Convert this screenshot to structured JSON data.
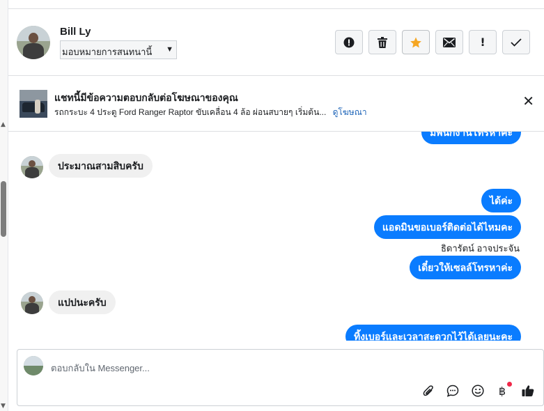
{
  "header": {
    "contact_name": "Bill Ly",
    "assign_label": "มอบหมายการสนทนานี้",
    "actions": [
      {
        "name": "spam",
        "icon": "alert-circle-icon"
      },
      {
        "name": "delete",
        "icon": "trash-icon"
      },
      {
        "name": "star",
        "icon": "star-icon",
        "color": "#f5a623"
      },
      {
        "name": "mark-unread",
        "icon": "envelope-icon"
      },
      {
        "name": "follow-up",
        "icon": "exclamation-icon"
      },
      {
        "name": "done",
        "icon": "check-icon"
      }
    ]
  },
  "banner": {
    "title": "แชทนี้มีข้อความตอบกลับต่อโฆษณาของคุณ",
    "subtitle": "รถกระบะ 4 ประตู Ford Ranger Raptor ขับเคลื่อน 4 ล้อ ผ่อนสบายๆ เริ่มต้น...",
    "link": "ดูโฆษณา"
  },
  "messages": [
    {
      "dir": "out",
      "text": "มีพนักงานโทรหาค่ะ"
    },
    {
      "dir": "in",
      "text": "ประมาณสามสิบครับ"
    },
    {
      "dir": "out",
      "text": "ได้ค่ะ"
    },
    {
      "dir": "out",
      "text": "แอดมินขอเบอร์ติดต่อได้ไหมคะ"
    },
    {
      "dir": "sender",
      "text": "ธิดารัตน์ อาจประจัน"
    },
    {
      "dir": "out",
      "text": "เดี๋ยวให้เซลล์โทรหาค่ะ"
    },
    {
      "dir": "in",
      "text": "แปปนะครับ"
    },
    {
      "dir": "out",
      "text": "ทิ้งเบอร์และเวลาสะดวกไว้ได้เลยนะคะ"
    }
  ],
  "composer": {
    "placeholder": "ตอบกลับใน Messenger...",
    "tools": [
      "paperclip-icon",
      "chat-bubble-icon",
      "emoji-icon",
      "baht-icon",
      "thumbs-up-icon"
    ]
  },
  "colors": {
    "outgoing_bubble": "#0a7cff",
    "incoming_bubble": "#f0f0f0",
    "link": "#1d64b8",
    "notification_dot": "#f02849"
  }
}
